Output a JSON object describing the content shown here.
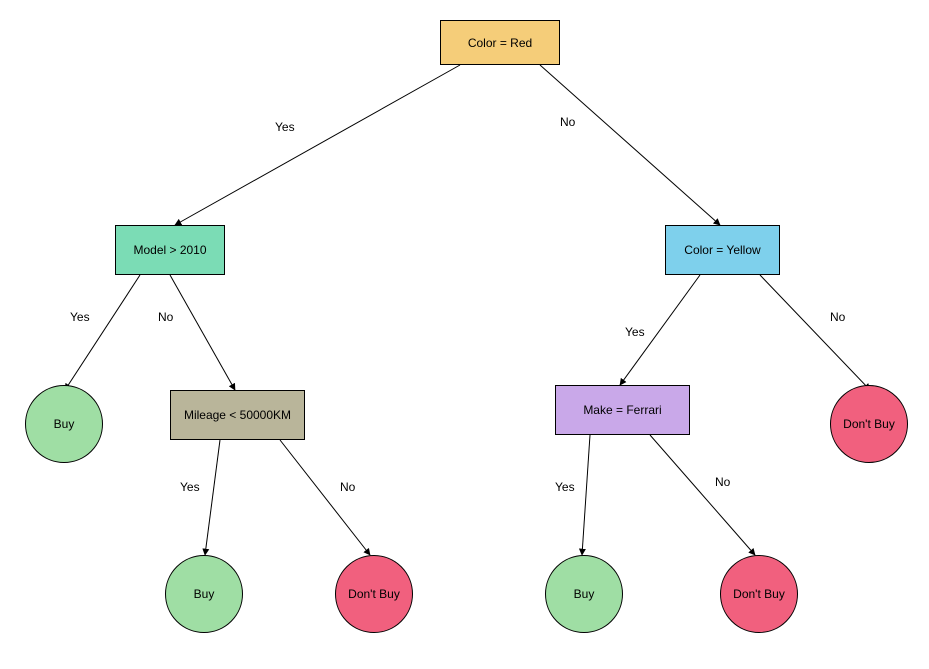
{
  "nodes": {
    "root": {
      "label": "Color = Red"
    },
    "model": {
      "label": "Model > 2010"
    },
    "coloryellow": {
      "label": "Color = Yellow"
    },
    "ferrari": {
      "label": "Make = Ferrari"
    },
    "mileage": {
      "label": "Mileage < 50000KM"
    },
    "buy1": {
      "label": "Buy"
    },
    "buy2": {
      "label": "Buy"
    },
    "buy3": {
      "label": "Buy"
    },
    "dontbuy1": {
      "label": "Don't Buy"
    },
    "dontbuy2": {
      "label": "Don't Buy"
    },
    "dontbuy3": {
      "label": "Don't Buy"
    }
  },
  "edges": {
    "root_yes": "Yes",
    "root_no": "No",
    "model_yes": "Yes",
    "model_no": "No",
    "yellow_yes": "Yes",
    "yellow_no": "No",
    "mileage_yes": "Yes",
    "mileage_no": "No",
    "ferrari_yes": "Yes",
    "ferrari_no": "No"
  },
  "colors": {
    "root": "#f5cd79",
    "teal": "#7bdcb5",
    "skyblue": "#7ed0ec",
    "khaki": "#b9b59a",
    "purple": "#c9a8e9",
    "green": "#9fdea4",
    "pink": "#f1607e"
  }
}
